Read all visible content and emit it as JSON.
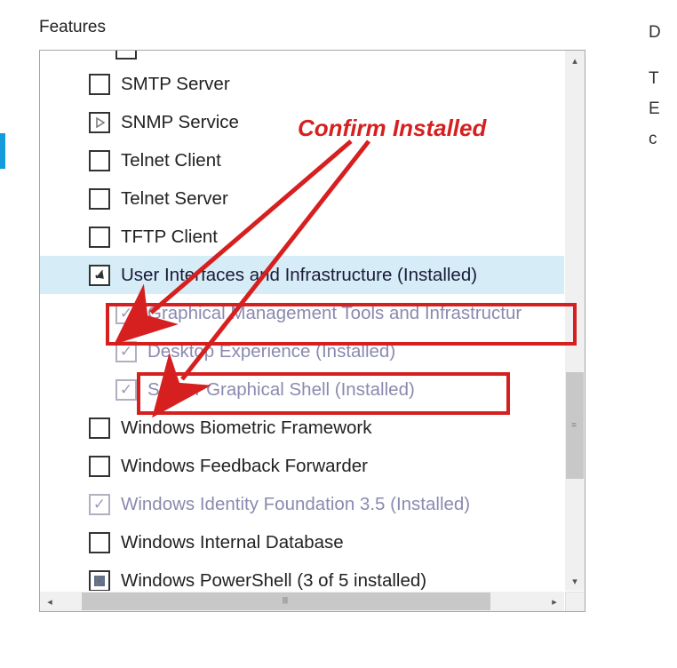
{
  "heading": "Features",
  "annotation": "Confirm Installed",
  "side_text": {
    "l1": "D",
    "l2": "T",
    "l3": "E",
    "l4": "c"
  },
  "items": [
    {
      "label": "SMTP Server",
      "checked": false,
      "disabled": false,
      "expander": null,
      "indent": 0
    },
    {
      "label": "SNMP Service",
      "checked": false,
      "disabled": false,
      "expander": "collapsed",
      "indent": 0
    },
    {
      "label": "Telnet Client",
      "checked": false,
      "disabled": false,
      "expander": null,
      "indent": 0
    },
    {
      "label": "Telnet Server",
      "checked": false,
      "disabled": false,
      "expander": null,
      "indent": 0
    },
    {
      "label": "TFTP Client",
      "checked": false,
      "disabled": false,
      "expander": null,
      "indent": 0
    },
    {
      "label": "User Interfaces and Infrastructure (Installed)",
      "checked": true,
      "disabled": false,
      "expander": "expanded",
      "indent": 0,
      "selected": true
    },
    {
      "label": "Graphical Management Tools and Infrastructur",
      "checked": true,
      "disabled": true,
      "expander": null,
      "indent": 1
    },
    {
      "label": "Desktop Experience (Installed)",
      "checked": true,
      "disabled": true,
      "expander": null,
      "indent": 1
    },
    {
      "label": "Server Graphical Shell (Installed)",
      "checked": true,
      "disabled": true,
      "expander": null,
      "indent": 1
    },
    {
      "label": "Windows Biometric Framework",
      "checked": false,
      "disabled": false,
      "expander": null,
      "indent": 0
    },
    {
      "label": "Windows Feedback Forwarder",
      "checked": false,
      "disabled": false,
      "expander": null,
      "indent": 0
    },
    {
      "label": "Windows Identity Foundation 3.5 (Installed)",
      "checked": true,
      "disabled": true,
      "expander": null,
      "indent": 0
    },
    {
      "label": "Windows Internal Database",
      "checked": false,
      "disabled": false,
      "expander": null,
      "indent": 0
    },
    {
      "label": "Windows PowerShell (3 of 5 installed)",
      "checked": "partial",
      "disabled": false,
      "expander": "collapsed",
      "indent": 0
    }
  ]
}
